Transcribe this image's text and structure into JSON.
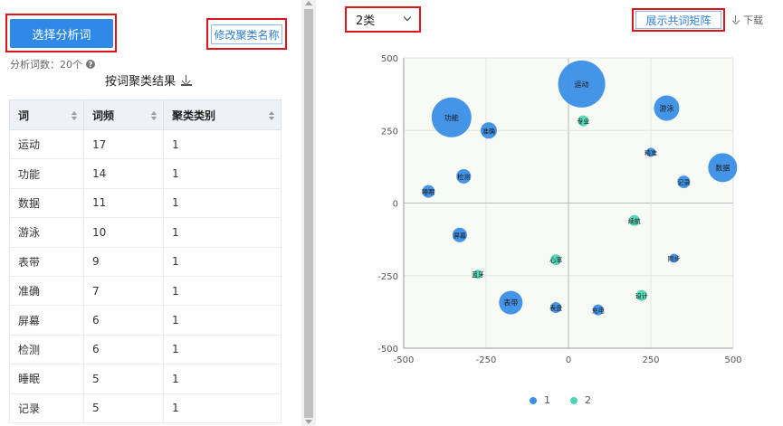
{
  "left": {
    "select_words_label": "选择分析词",
    "rename_cluster_label": "修改聚类名称",
    "word_count_text": "分析词数：20个",
    "result_title": "按词聚类结果",
    "table": {
      "headers": [
        "词",
        "词频",
        "聚类类别"
      ],
      "rows": [
        [
          "运动",
          "17",
          "1"
        ],
        [
          "功能",
          "14",
          "1"
        ],
        [
          "数据",
          "11",
          "1"
        ],
        [
          "游泳",
          "10",
          "1"
        ],
        [
          "表带",
          "9",
          "1"
        ],
        [
          "准确",
          "7",
          "1"
        ],
        [
          "屏幕",
          "6",
          "1"
        ],
        [
          "检测",
          "6",
          "1"
        ],
        [
          "睡眠",
          "5",
          "1"
        ],
        [
          "记录",
          "5",
          "1"
        ]
      ]
    }
  },
  "right": {
    "cluster_select_value": "2类",
    "show_matrix_label": "展示共词矩阵",
    "download_label": "下载"
  },
  "colors": {
    "primary": "#2e8ae6",
    "cluster1": "#3a8ee6",
    "cluster2": "#4ed4b4",
    "highlight_red": "#e0141e"
  },
  "chart_data": {
    "type": "scatter",
    "title": "",
    "xlabel": "",
    "ylabel": "",
    "xlim": [
      -500,
      500
    ],
    "ylim": [
      -500,
      500
    ],
    "x_ticks": [
      "-500",
      "-250",
      "0",
      "250",
      "500"
    ],
    "y_ticks": [
      "500",
      "250",
      "0",
      "-250",
      "-500"
    ],
    "grid": true,
    "legend": "bottom",
    "series": [
      {
        "name": "1",
        "color": "#3a8ee6",
        "points": [
          {
            "label": "运动",
            "x": 40,
            "y": 410,
            "size": 17
          },
          {
            "label": "功能",
            "x": -355,
            "y": 295,
            "size": 14
          },
          {
            "label": "数据",
            "x": 468,
            "y": 122,
            "size": 11
          },
          {
            "label": "游泳",
            "x": 298,
            "y": 327,
            "size": 10
          },
          {
            "label": "表带",
            "x": -175,
            "y": -343,
            "size": 9
          },
          {
            "label": "准确",
            "x": -242,
            "y": 250,
            "size": 7
          },
          {
            "label": "屏幕",
            "x": -330,
            "y": -110,
            "size": 6
          },
          {
            "label": "检测",
            "x": -318,
            "y": 92,
            "size": 6
          },
          {
            "label": "睡眠",
            "x": -425,
            "y": 40,
            "size": 5
          },
          {
            "label": "记录",
            "x": 350,
            "y": 73,
            "size": 5
          },
          {
            "label": "精准",
            "x": 250,
            "y": 175,
            "size": 3
          },
          {
            "label": "同步",
            "x": 320,
            "y": -190,
            "size": 3
          },
          {
            "label": "表盘",
            "x": -38,
            "y": -360,
            "size": 4
          },
          {
            "label": "充电",
            "x": 90,
            "y": -368,
            "size": 4
          }
        ]
      },
      {
        "name": "2",
        "color": "#4ed4b4",
        "points": [
          {
            "label": "专业",
            "x": 45,
            "y": 283,
            "size": 4
          },
          {
            "label": "续航",
            "x": 200,
            "y": -60,
            "size": 4
          },
          {
            "label": "心率",
            "x": -38,
            "y": -195,
            "size": 4
          },
          {
            "label": "蓝牙",
            "x": -275,
            "y": -245,
            "size": 3
          },
          {
            "label": "设计",
            "x": 222,
            "y": -318,
            "size": 4
          }
        ]
      }
    ]
  }
}
